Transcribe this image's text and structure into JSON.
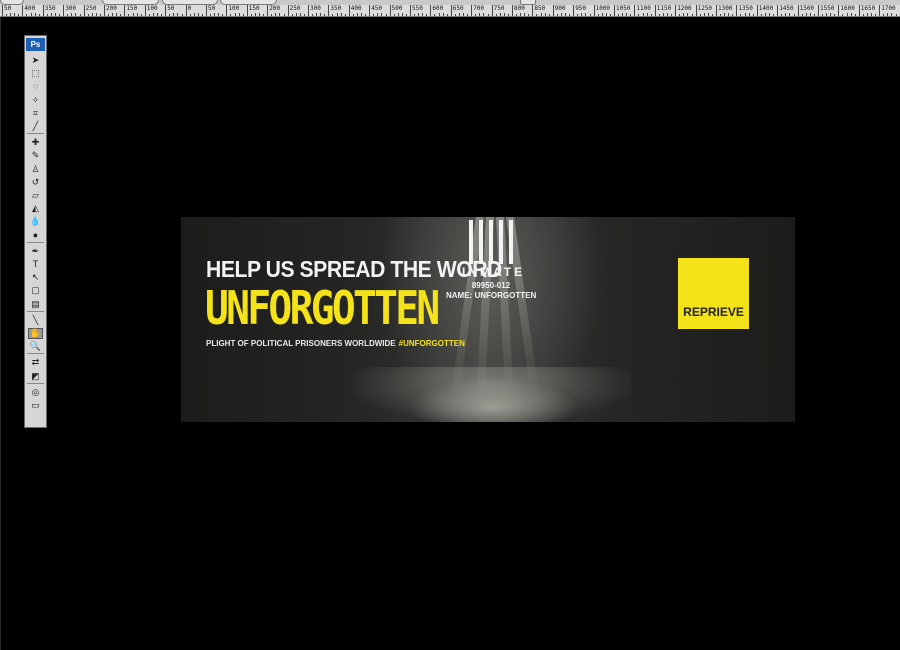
{
  "app": {
    "name": "Photoshop"
  },
  "tools_panel": {
    "badge": "Ps",
    "tools": [
      {
        "name": "move-tool",
        "glyph": "➤"
      },
      {
        "name": "marquee-tool",
        "glyph": "⬚"
      },
      {
        "name": "lasso-tool",
        "glyph": "◌"
      },
      {
        "name": "magic-wand-tool",
        "glyph": "✧"
      },
      {
        "name": "crop-tool",
        "glyph": "⌗"
      },
      {
        "name": "eyedropper-tool",
        "glyph": "╱"
      },
      {
        "name": "healing-brush-tool",
        "glyph": "✚"
      },
      {
        "name": "brush-tool",
        "glyph": "✎"
      },
      {
        "name": "clone-stamp-tool",
        "glyph": "♙"
      },
      {
        "name": "history-brush-tool",
        "glyph": "↺"
      },
      {
        "name": "eraser-tool",
        "glyph": "▱"
      },
      {
        "name": "paint-bucket-tool",
        "glyph": "◭"
      },
      {
        "name": "blur-tool",
        "glyph": "💧"
      },
      {
        "name": "dodge-tool",
        "glyph": "●"
      },
      {
        "name": "pen-tool",
        "glyph": "✒"
      },
      {
        "name": "type-tool",
        "glyph": "T"
      },
      {
        "name": "path-selection-tool",
        "glyph": "↖"
      },
      {
        "name": "shape-tool",
        "glyph": "▢"
      },
      {
        "name": "notes-tool",
        "glyph": "▤"
      },
      {
        "name": "eyedropper-2-tool",
        "glyph": "╲"
      },
      {
        "name": "hand-tool",
        "glyph": "✋",
        "active": true
      },
      {
        "name": "zoom-tool",
        "glyph": "🔍"
      },
      {
        "name": "swap-colors",
        "glyph": "⇄"
      },
      {
        "name": "color-swatches",
        "glyph": "◩"
      },
      {
        "name": "quick-mask",
        "glyph": "◎"
      },
      {
        "name": "screen-mode",
        "glyph": "▭"
      }
    ]
  },
  "ruler": {
    "labels": [
      "50",
      "400",
      "350",
      "300",
      "250",
      "200",
      "150",
      "100",
      "50",
      "0",
      "50",
      "100",
      "150",
      "200",
      "250",
      "300",
      "350",
      "400",
      "450",
      "500",
      "550",
      "600",
      "650",
      "700",
      "750",
      "800",
      "850",
      "900",
      "950",
      "1000",
      "1050",
      "1100",
      "1150",
      "1200",
      "1250",
      "1300",
      "1350",
      "1400",
      "1450",
      "1500",
      "1550",
      "1600",
      "1650",
      "1700"
    ]
  },
  "banner": {
    "headline": "HELP US SPREAD THE WORD",
    "title": "UNFORGOTTEN",
    "tagline": "PLIGHT OF POLITICAL PRISONERS WORLDWIDE",
    "hashtag": "#UNFORGOTTEN",
    "inmate_label": "INMATE",
    "inmate_number": "89950-012",
    "inmate_name": "NAME: UNFORGOTTEN",
    "logo_text": "REPRIEVE",
    "colors": {
      "accent": "#f4e319",
      "background": "#1c1c1b"
    }
  }
}
